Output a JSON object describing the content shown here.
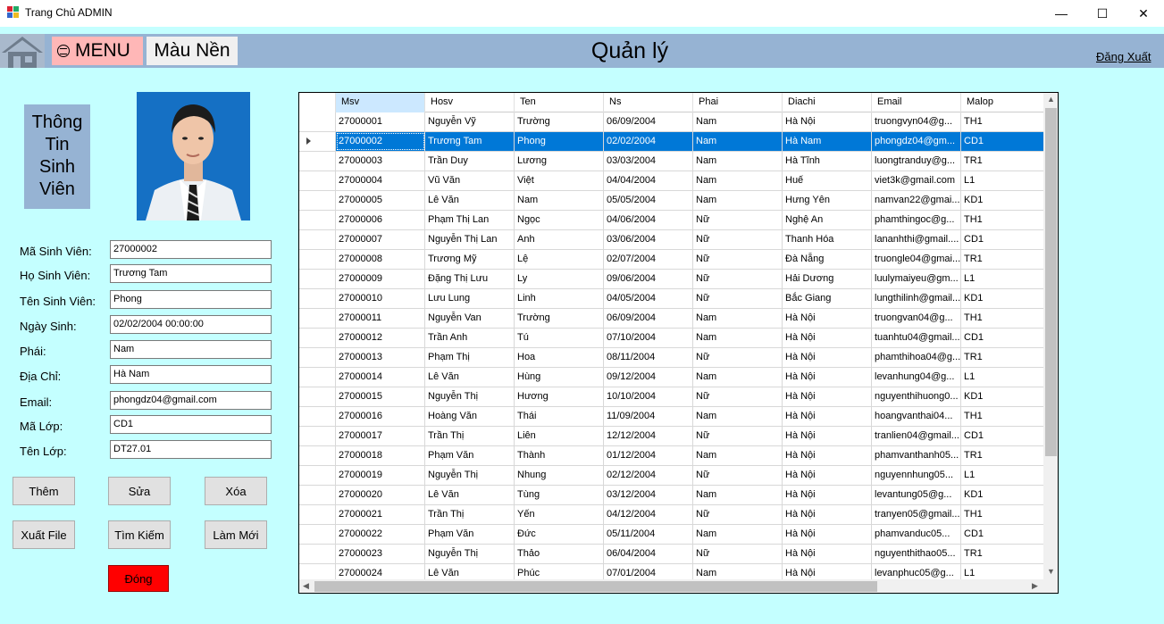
{
  "window": {
    "title": "Trang Chủ ADMIN",
    "minimize": "—",
    "maximize": "☐",
    "close": "✕"
  },
  "topbar": {
    "menu_label": "MENU",
    "background_label": "Màu Nền",
    "page_title": "Quản lý",
    "logout_label": "Đăng Xuất"
  },
  "info_box": {
    "line1": "Thông",
    "line2": "Tin",
    "line3": "Sinh",
    "line4": "Viên"
  },
  "form": {
    "fields": [
      {
        "label": "Mã Sinh Viên:",
        "value": "27000002"
      },
      {
        "label": "Họ Sinh Viên:",
        "value": "Trương Tam"
      },
      {
        "label": "Tên Sinh Viên:",
        "value": "Phong"
      },
      {
        "label": "Ngày Sinh:",
        "value": "02/02/2004 00:00:00"
      },
      {
        "label": "Phái:",
        "value": "Nam"
      },
      {
        "label": "Địa Chỉ:",
        "value": "Hà Nam"
      },
      {
        "label": "Email:",
        "value": "phongdz04@gmail.com"
      },
      {
        "label": "Mã Lớp:",
        "value": "CD1"
      },
      {
        "label": "Tên Lớp:",
        "value": "DT27.01"
      }
    ]
  },
  "buttons": {
    "add": "Thêm",
    "edit": "Sửa",
    "delete": "Xóa",
    "export": "Xuất File",
    "search": "Tìm Kiếm",
    "refresh": "Làm Mới",
    "close": "Đóng"
  },
  "colors": {
    "background": "#c4ffff",
    "topbar": "#96b3d3",
    "menu": "#ffb7b7",
    "selected_row": "#0078d7",
    "close_button": "#ff0000"
  },
  "grid": {
    "columns": [
      "Msv",
      "Hosv",
      "Ten",
      "Ns",
      "Phai",
      "Diachi",
      "Email",
      "Malop"
    ],
    "selected_index": 1,
    "rows": [
      [
        "27000001",
        "Nguyễn Vỹ",
        "Trường",
        "06/09/2004",
        "Nam",
        "Hà Nội",
        "truongvyn04@g...",
        "TH1"
      ],
      [
        "27000002",
        "Trương Tam",
        "Phong",
        "02/02/2004",
        "Nam",
        "Hà Nam",
        "phongdz04@gm...",
        "CD1"
      ],
      [
        "27000003",
        "Trần Duy",
        "Lương",
        "03/03/2004",
        "Nam",
        "Hà Tĩnh",
        "luongtranduy@g...",
        "TR1"
      ],
      [
        "27000004",
        "Vũ Văn",
        "Việt",
        "04/04/2004",
        "Nam",
        "Huế",
        "viet3k@gmail.com",
        "L1"
      ],
      [
        "27000005",
        "Lê Văn",
        "Nam",
        "05/05/2004",
        "Nam",
        "Hưng Yên",
        "namvan22@gmai...",
        "KD1"
      ],
      [
        "27000006",
        "Phạm Thị Lan",
        "Ngọc",
        "04/06/2004",
        "Nữ",
        "Nghệ An",
        "phamthingoc@g...",
        "TH1"
      ],
      [
        "27000007",
        "Nguyễn Thị Lan",
        "Anh",
        "03/06/2004",
        "Nữ",
        "Thanh Hóa",
        "lananhthi@gmail....",
        "CD1"
      ],
      [
        "27000008",
        "Trương Mỹ",
        "Lệ",
        "02/07/2004",
        "Nữ",
        "Đà Nẵng",
        "truongle04@gmai...",
        "TR1"
      ],
      [
        "27000009",
        "Đặng Thị Lưu",
        "Ly",
        "09/06/2004",
        "Nữ",
        "Hải Dương",
        "luulymaiyeu@gm...",
        "L1"
      ],
      [
        "27000010",
        "Lưu Lung",
        "Linh",
        "04/05/2004",
        "Nữ",
        "Bắc Giang",
        "lungthilinh@gmail...",
        "KD1"
      ],
      [
        "27000011",
        "Nguyễn Van",
        "Trường",
        "06/09/2004",
        "Nam",
        "Hà Nội",
        "truongvan04@g...",
        "TH1"
      ],
      [
        "27000012",
        "Trần Anh",
        "Tú",
        "07/10/2004",
        "Nam",
        "Hà Nội",
        "tuanhtu04@gmail...",
        "CD1"
      ],
      [
        "27000013",
        "Phạm Thị",
        "Hoa",
        "08/11/2004",
        "Nữ",
        "Hà Nội",
        "phamthihoa04@g...",
        "TR1"
      ],
      [
        "27000014",
        "Lê Văn",
        "Hùng",
        "09/12/2004",
        "Nam",
        "Hà Nội",
        "levanhung04@g...",
        "L1"
      ],
      [
        "27000015",
        "Nguyễn Thị",
        "Hương",
        "10/10/2004",
        "Nữ",
        "Hà Nội",
        "nguyenthihuong0...",
        "KD1"
      ],
      [
        "27000016",
        "Hoàng Văn",
        "Thái",
        "11/09/2004",
        "Nam",
        "Hà Nội",
        "hoangvanthai04...",
        "TH1"
      ],
      [
        "27000017",
        "Trần Thị",
        "Liên",
        "12/12/2004",
        "Nữ",
        "Hà Nội",
        "tranlien04@gmail...",
        "CD1"
      ],
      [
        "27000018",
        "Phạm Văn",
        "Thành",
        "01/12/2004",
        "Nam",
        "Hà Nội",
        "phamvanthanh05...",
        "TR1"
      ],
      [
        "27000019",
        "Nguyễn Thị",
        "Nhung",
        "02/12/2004",
        "Nữ",
        "Hà Nội",
        "nguyennhung05...",
        "L1"
      ],
      [
        "27000020",
        "Lê Văn",
        "Tùng",
        "03/12/2004",
        "Nam",
        "Hà Nội",
        "levantung05@g...",
        "KD1"
      ],
      [
        "27000021",
        "Trần Thị",
        "Yến",
        "04/12/2004",
        "Nữ",
        "Hà Nội",
        "tranyen05@gmail...",
        "TH1"
      ],
      [
        "27000022",
        "Phạm Văn",
        "Đức",
        "05/11/2004",
        "Nam",
        "Hà Nội",
        "phamvanduc05...",
        "CD1"
      ],
      [
        "27000023",
        "Nguyễn Thị",
        "Thảo",
        "06/04/2004",
        "Nữ",
        "Hà Nội",
        "nguyenthithao05...",
        "TR1"
      ],
      [
        "27000024",
        "Lê Văn",
        "Phúc",
        "07/01/2004",
        "Nam",
        "Hà Nội",
        "levanphuc05@g...",
        "L1"
      ]
    ]
  }
}
